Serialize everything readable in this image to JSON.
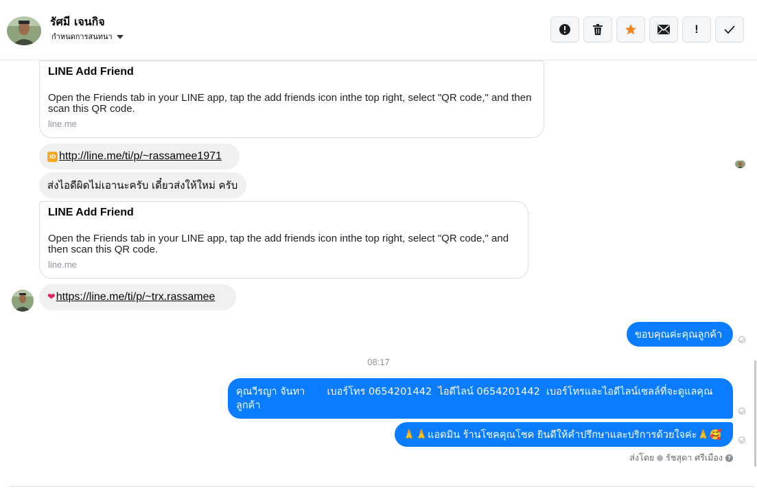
{
  "header": {
    "contact_name": "รัศมี เจนกิจ",
    "assign_label": "กำหนดการสนทนา",
    "tools": [
      {
        "name": "spam-icon",
        "label": "!"
      },
      {
        "name": "trash-icon",
        "label": ""
      },
      {
        "name": "star-icon",
        "label": ""
      },
      {
        "name": "mail-icon",
        "label": ""
      },
      {
        "name": "follow-up-icon",
        "label": "!"
      },
      {
        "name": "checkmark-icon",
        "label": "✓"
      }
    ]
  },
  "messages": {
    "card1": {
      "title": "LINE Add Friend",
      "desc": "Open the Friends tab in your LINE app, tap the add friends icon inthe top right, select \"QR code,\" and then scan this QR code.",
      "domain": "line.me"
    },
    "link1": {
      "emoji": "ID",
      "url": "http://line.me/ti/p/~rassamee1971"
    },
    "text1": "ส่งไอดีผิดไม่เอานะครับ เดี๋ยวส่งให้ใหม่ ครับ",
    "card2": {
      "title": "LINE Add Friend",
      "desc": "Open the Friends tab in your LINE app, tap the add friends icon inthe top right, select \"QR code,\" and then scan this QR code.",
      "domain": "line.me"
    },
    "link2": {
      "emoji": "❤",
      "url": "https://line.me/ti/p/~trx.rassamee"
    },
    "out1": "ขอบคุณค่ะคุณลูกค้า",
    "timestamp": "08:17",
    "out2_line1": "คุณวีรญา จันทา       เบอร์โทร 0654201442  ไอดีไลน์ 0654201442  เบอร์โทรและไอดีไลน์เซลล์ที่จะดูแลคุณ",
    "out2_line2": "ลูกค้า",
    "out3": "🙏🙏แอดมิน ร้านโชคคุณโชค ยินดีให้คำปรึกษาและบริการด้วยใจค่ะ🙏🥰",
    "sent_by_label": "ส่งโดย",
    "sent_by_name": "รัชสุดา ศรีเมือง"
  },
  "colors": {
    "outgoing": "#0a7cff",
    "incoming": "#f0f0f0",
    "star": "#f5831f"
  }
}
